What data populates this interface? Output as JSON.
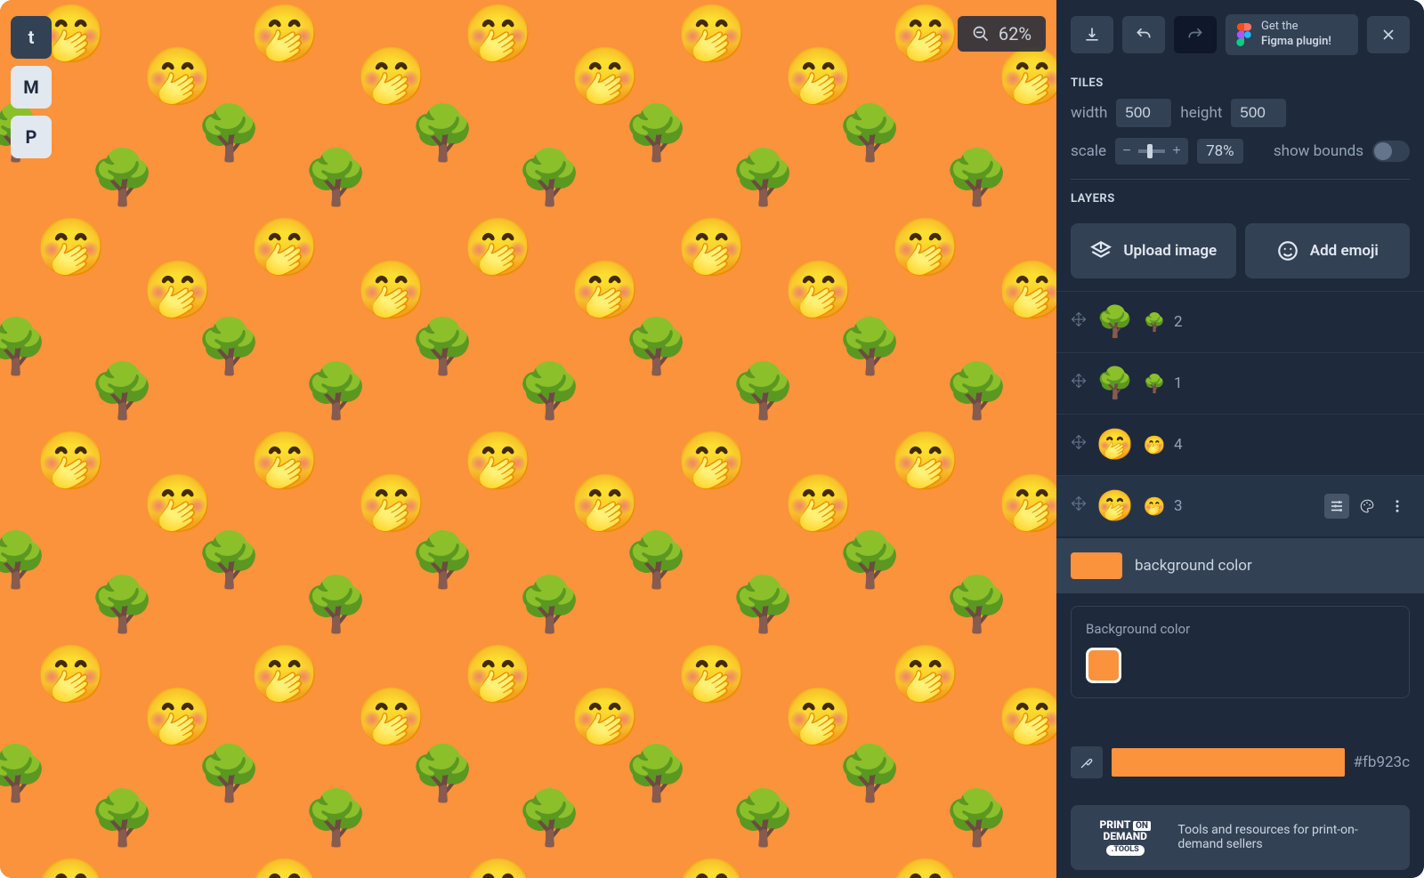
{
  "zoom": {
    "level": "62%"
  },
  "social": {
    "tumblr": "t",
    "medium": "M",
    "pinterest": "P"
  },
  "topbar": {
    "figma_line1": "Get the",
    "figma_line2": "Figma plugin!"
  },
  "tiles": {
    "title": "TILES",
    "width_label": "width",
    "width_value": "500",
    "height_label": "height",
    "height_value": "500",
    "scale_label": "scale",
    "scale_value": "78%",
    "show_bounds_label": "show bounds"
  },
  "layers": {
    "title": "LAYERS",
    "upload_label": "Upload image",
    "add_emoji_label": "Add emoji",
    "items": [
      {
        "emoji": "🌳",
        "index": "2"
      },
      {
        "emoji": "🌳",
        "index": "1"
      },
      {
        "emoji": "🤭",
        "index": "4"
      },
      {
        "emoji": "🤭",
        "index": "3"
      }
    ],
    "bg_label": "background color",
    "bg_edit_label": "Background color"
  },
  "color": {
    "hex": "#fb923c"
  },
  "promo": {
    "brand_pre": "PRINT",
    "brand_mid": "ON",
    "brand_post": "DEMAND",
    "brand_sub": ".TOOLS",
    "text": "Tools and resources for print-on-demand sellers"
  },
  "pattern": {
    "bg": "#fb923c",
    "tree_emoji": "🌳",
    "face_emoji": "🤭"
  }
}
